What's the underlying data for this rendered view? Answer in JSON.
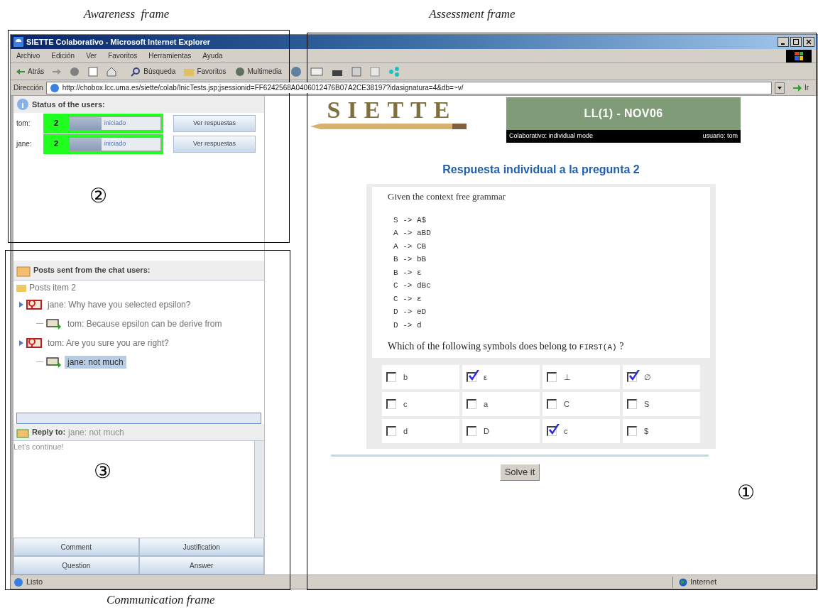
{
  "captions": {
    "awareness": "Awareness  frame",
    "assessment": "Assessment frame",
    "communication": "Communication frame"
  },
  "annotations": [
    "②",
    "③",
    "①"
  ],
  "window": {
    "title": "SIETTE Colaborativo - Microsoft Internet Explorer"
  },
  "menu": [
    "Archivo",
    "Edición",
    "Ver",
    "Favoritos",
    "Herramientas",
    "Ayuda"
  ],
  "toolbar": {
    "back": "Atrás",
    "search": "Búsqueda",
    "favorites": "Favoritos",
    "media": "Multimedia"
  },
  "address": {
    "label": "Dirección",
    "url": "http://chobox.lcc.uma.es/siette/colab/InicTests.jsp;jsessionid=FF6242568A0406012476B07A2CE38197?idasignatura=4&db=~v/",
    "go": "Ir"
  },
  "awareness": {
    "title": "Status of the users:",
    "users": [
      {
        "name": "tom:",
        "item": "2",
        "status": "iniciado",
        "level": 0.35,
        "button": "Ver respuestas"
      },
      {
        "name": "jane:",
        "item": "2",
        "status": "iniciado",
        "level": 0.35,
        "button": "Ver respuestas"
      }
    ]
  },
  "posts": {
    "title": "Posts sent from the chat users:",
    "root": "Posts item 2",
    "items": [
      {
        "kind": "question",
        "text": "jane: Why have you selected epsilon?",
        "selected": false,
        "children": [
          {
            "kind": "answer",
            "text": "tom: Because epsilon can be derive from",
            "selected": false
          }
        ]
      },
      {
        "kind": "question",
        "text": "tom: Are you sure you are right?",
        "selected": false,
        "children": [
          {
            "kind": "answer",
            "text": "jane: not much",
            "selected": true
          }
        ]
      }
    ]
  },
  "reply": {
    "label": "Reply to:",
    "target": "jane: not much",
    "value": "Let's continue!"
  },
  "chat_buttons": [
    "Comment",
    "Justification",
    "Question",
    "Answer"
  ],
  "status_bar": {
    "text": "Listo",
    "zone": "Internet"
  },
  "assessment": {
    "logo": "SIETTE",
    "test": "LL(1) - NOV06",
    "mode": "Colaborativo: individual mode",
    "user": "usuario: tom",
    "heading": "Respuesta individual a la pregunta 2",
    "intro": "Given the context free grammar",
    "grammar": [
      "S -> A$",
      "A -> aBD",
      "A -> CB",
      "B -> bB",
      "B -> ε",
      "C -> dBc",
      "C -> ε",
      "D -> eD",
      "D -> d"
    ],
    "question": {
      "text": "Which of the following symbols does belong to",
      "code": "FIRST(A)",
      "end": "?"
    },
    "options": [
      {
        "label": "b",
        "checked": false
      },
      {
        "label": "ε",
        "checked": true
      },
      {
        "label": "⊥",
        "checked": false
      },
      {
        "label": "∅",
        "checked": true
      },
      {
        "label": "c",
        "checked": false
      },
      {
        "label": "a",
        "checked": false
      },
      {
        "label": "C",
        "checked": false
      },
      {
        "label": "S",
        "checked": false
      },
      {
        "label": "d",
        "checked": false
      },
      {
        "label": "D",
        "checked": false
      },
      {
        "label": "c",
        "checked": true
      },
      {
        "label": "$",
        "checked": false
      }
    ],
    "button": "Solve it"
  }
}
